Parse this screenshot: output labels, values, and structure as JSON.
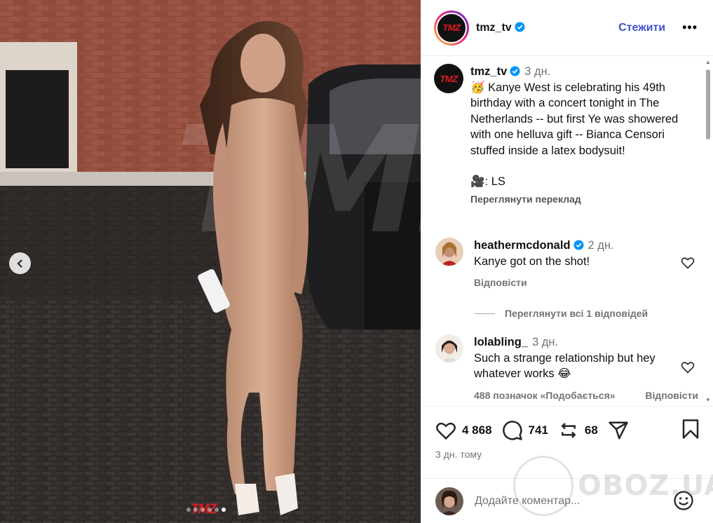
{
  "post": {
    "username": "tmz_tv",
    "follow_label": "Стежити",
    "more_label": "•••",
    "media_watermark": "TMZ",
    "carousel": {
      "count": 6,
      "active_index": 5
    }
  },
  "caption": {
    "username": "tmz_tv",
    "time": "3 дн.",
    "emoji": "🥳",
    "text": "Kanye West is celebrating his 49th birthday with a concert tonight in The Netherlands -- but first Ye was showered with one helluva gift -- Bianca Censori stuffed inside a latex bodysuit!",
    "credit_emoji": "🎥",
    "credit": ": LS",
    "translate_label": "Переглянути переклад"
  },
  "comments": [
    {
      "username": "heathermcdonald",
      "verified": true,
      "time": "2 дн.",
      "text": "Kanye got on the shot!",
      "reply_label": "Відповісти"
    },
    {
      "username": "lolabling_",
      "verified": false,
      "time": "3 дн.",
      "text": "Such a strange relationship but hey whatever works",
      "emoji": "😂",
      "likes_label": "488 позначок «Подобається»",
      "reply_label": "Відповісти"
    }
  ],
  "view_replies_label": "Переглянути всі 1 відповідей",
  "actions": {
    "likes": "4 868",
    "comments": "741",
    "reposts": "68"
  },
  "posted_label": "3 дн. тому",
  "add_comment": {
    "placeholder": "Додайте коментар..."
  },
  "site_watermark": "OBOZ.UA",
  "colors": {
    "accent": "#3f54c9",
    "verified": "#0095f6",
    "brand_red": "#e01b22"
  }
}
